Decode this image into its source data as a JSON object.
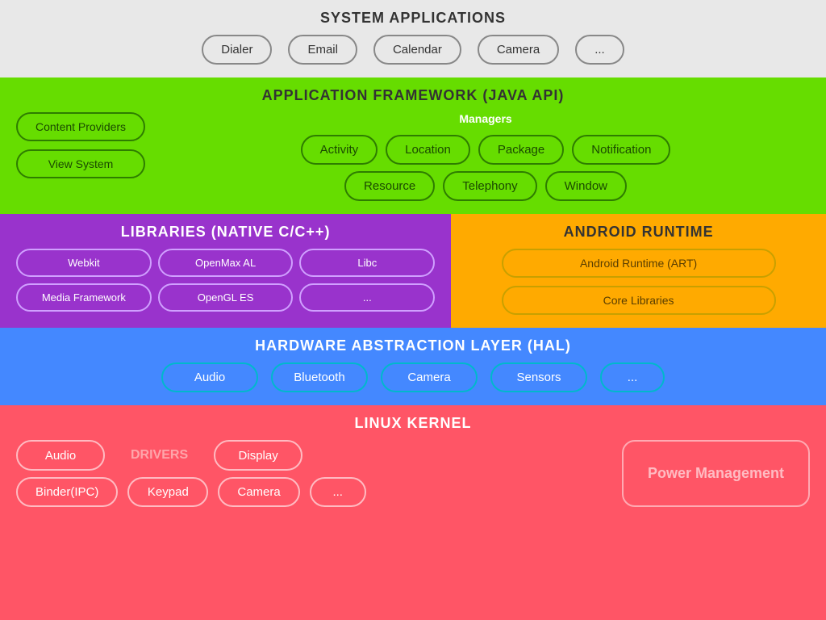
{
  "system_apps": {
    "title": "SYSTEM APPLICATIONS",
    "apps": [
      "Dialer",
      "Email",
      "Calendar",
      "Camera",
      "..."
    ]
  },
  "app_framework": {
    "title": "APPLICATION FRAMEWORK (JAVA API)",
    "left_items": [
      "Content Providers",
      "View System"
    ],
    "managers_label": "Managers",
    "managers_row1": [
      "Activity",
      "Location",
      "Package",
      "Notification"
    ],
    "managers_row2": [
      "Resource",
      "Telephony",
      "Window"
    ]
  },
  "libraries": {
    "title": "LIBRARIES (NATIVE C/C++)",
    "items": [
      "Webkit",
      "OpenMax AL",
      "Libc",
      "Media Framework",
      "OpenGL ES",
      "..."
    ]
  },
  "android_runtime": {
    "title": "ANDROID RUNTIME",
    "items": [
      "Android Runtime (ART)",
      "Core Libraries"
    ]
  },
  "hal": {
    "title": "HARDWARE ABSTRACTION LAYER (HAL)",
    "items": [
      "Audio",
      "Bluetooth",
      "Camera",
      "Sensors",
      "..."
    ]
  },
  "linux_kernel": {
    "title": "LINUX KERNEL",
    "drivers_label": "DRIVERS",
    "row1": [
      "Audio",
      "Display"
    ],
    "row2": [
      "Binder(IPC)",
      "Keypad",
      "Camera",
      "..."
    ],
    "power_management": "Power Management"
  }
}
